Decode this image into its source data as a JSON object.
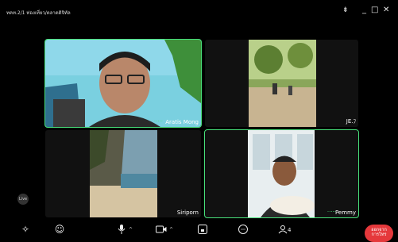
{
  "window": {
    "title": "ทคท.2/1 ท่องเที่ยว/ตลาดดิจิทัล",
    "pin_icon": "pin-icon",
    "minimize_label": "_",
    "maximize_label": "□",
    "close_label": "✕"
  },
  "top_controls": {
    "grid_icon": "grid-view-icon",
    "settings_icon": "gear-icon"
  },
  "participants": [
    {
      "name": "Aratis Mong",
      "active": true
    },
    {
      "name": "JE.ﾌ",
      "active": false
    },
    {
      "name": "Siriporn",
      "active": false
    },
    {
      "name": "Pemmy",
      "active": true
    }
  ],
  "status_chip": {
    "label": "Live"
  },
  "toolbar": {
    "items": [
      {
        "icon": "effects-sparkle-icon"
      },
      {
        "icon": "emoji-icon"
      },
      {
        "icon": "microphone-icon"
      },
      {
        "icon": "camera-icon"
      },
      {
        "icon": "share-screen-icon"
      },
      {
        "icon": "chat-icon"
      },
      {
        "icon": "participants-icon",
        "count": "4"
      }
    ],
    "leave_label_line1": "ออกจาก",
    "leave_label_line2": "การโทร"
  },
  "colors": {
    "active_border": "#48e07a",
    "leave_button": "#e5383b",
    "background": "#000000"
  }
}
